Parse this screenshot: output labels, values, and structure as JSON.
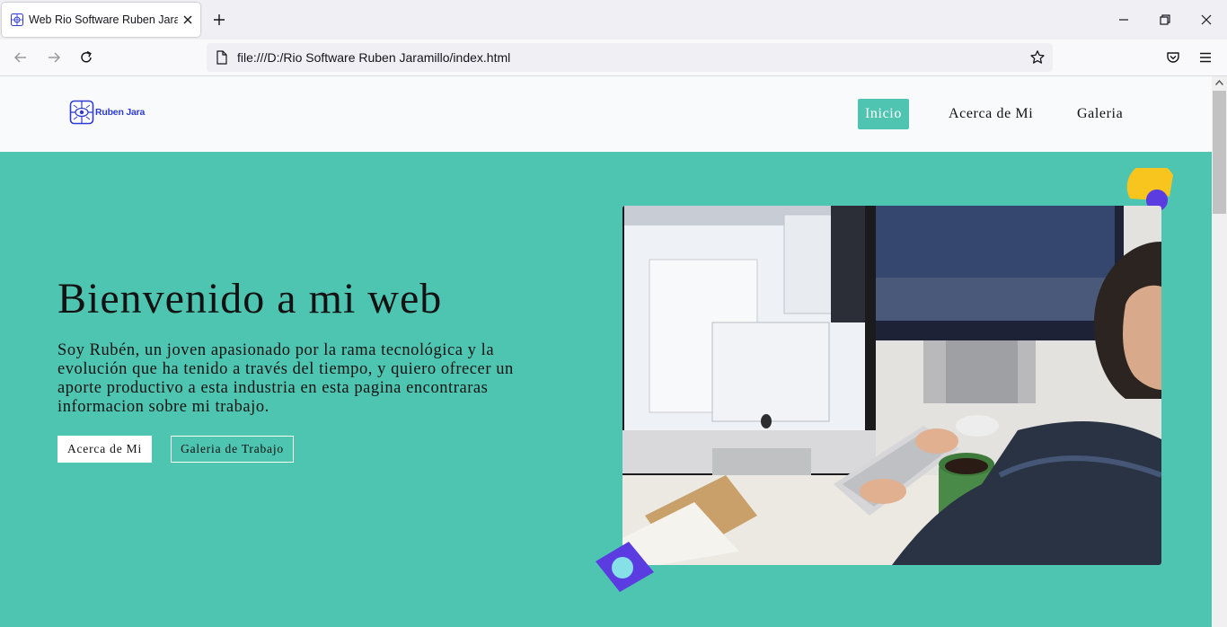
{
  "browser": {
    "tab_title": "Web Rio Software Ruben Jaramillo",
    "url": "file:///D:/Rio Software Ruben Jaramillo/index.html"
  },
  "site": {
    "brand": "Ruben Jara",
    "nav": [
      {
        "label": "Inicio",
        "active": true
      },
      {
        "label": "Acerca de Mi",
        "active": false
      },
      {
        "label": "Galeria",
        "active": false
      }
    ],
    "hero": {
      "title": "Bienvenido a mi web",
      "text": "Soy Rubén, un joven apasionado por la rama tecnológica y la evolución que ha tenido a través del tiempo, y quiero ofrecer un aporte productivo a esta industria en esta pagina encontraras informacion sobre mi trabajo.",
      "primary_button": "Acerca de Mi",
      "secondary_button": "Galeria de Trabajo"
    }
  },
  "colors": {
    "accent": "#4ec5b1",
    "brand": "#2d3bd3",
    "deco_yellow": "#f7c51e",
    "deco_purple": "#5b3ce0"
  }
}
